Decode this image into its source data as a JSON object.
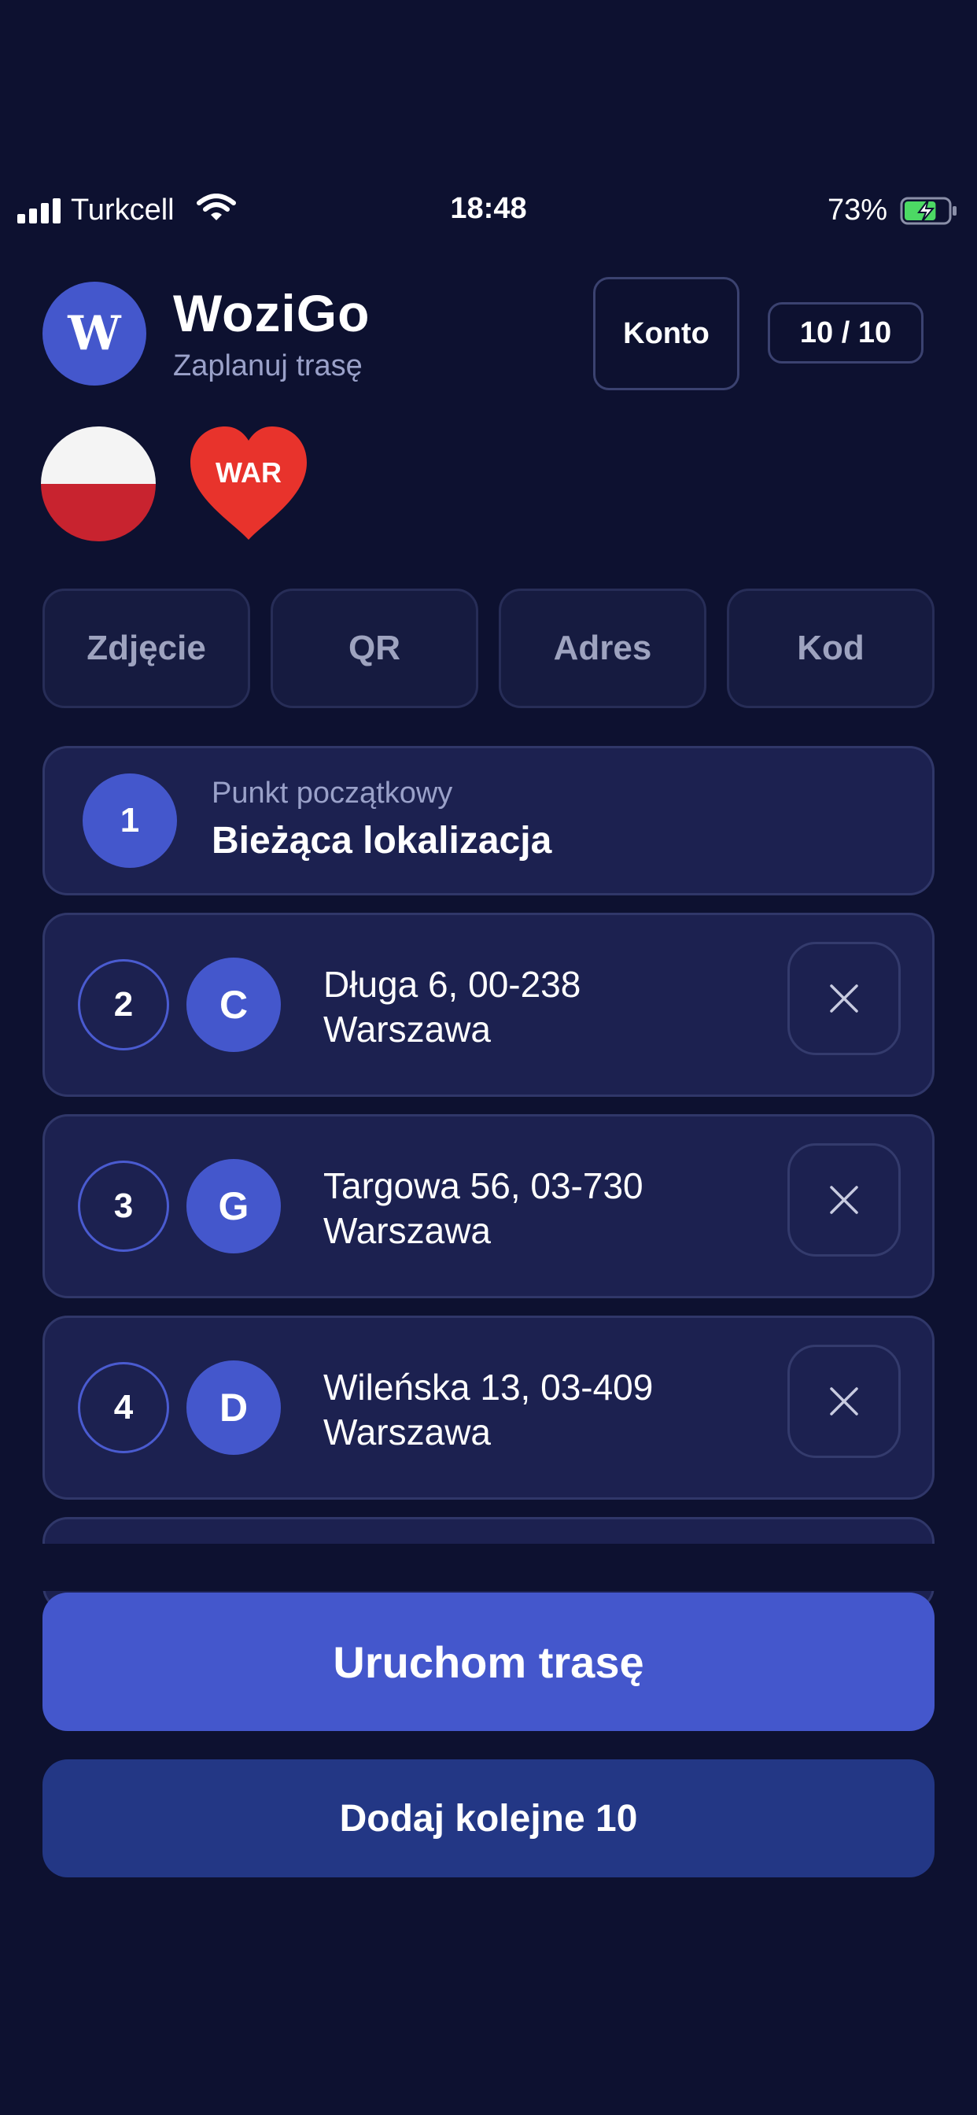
{
  "status_bar": {
    "carrier": "Turkcell",
    "time": "18:48",
    "battery_percent": "73%",
    "battery_level": 0.73,
    "icons": [
      "signal-icon",
      "wifi-icon",
      "battery-charging-icon"
    ]
  },
  "header": {
    "logo_letter": "W",
    "title": "WoziGo",
    "subtitle": "Zaplanuj trasę",
    "account_button": "Konto",
    "counter": "10 / 10"
  },
  "badges": {
    "country_flag": "poland-flag-icon",
    "city_code": "WAR"
  },
  "input_modes": [
    "Zdjęcie",
    "QR",
    "Adres",
    "Kod"
  ],
  "start_point": {
    "number": "1",
    "label": "Punkt początkowy",
    "value": "Bieżąca lokalizacja"
  },
  "stops": [
    {
      "number": "2",
      "letter": "C",
      "line1": "Długa 6, 00-238",
      "line2": "Warszawa"
    },
    {
      "number": "3",
      "letter": "G",
      "line1": "Targowa 56, 03-730",
      "line2": "Warszawa"
    },
    {
      "number": "4",
      "letter": "D",
      "line1": "Wileńska 13, 03-409",
      "line2": "Warszawa"
    }
  ],
  "actions": {
    "start_route": "Uruchom trasę",
    "add_more": "Dodaj kolejne 10"
  },
  "colors": {
    "background": "#0d1130",
    "accent": "#4457cc",
    "card": "#1c2150",
    "secondary_button": "#233785",
    "heart": "#e8332c"
  }
}
